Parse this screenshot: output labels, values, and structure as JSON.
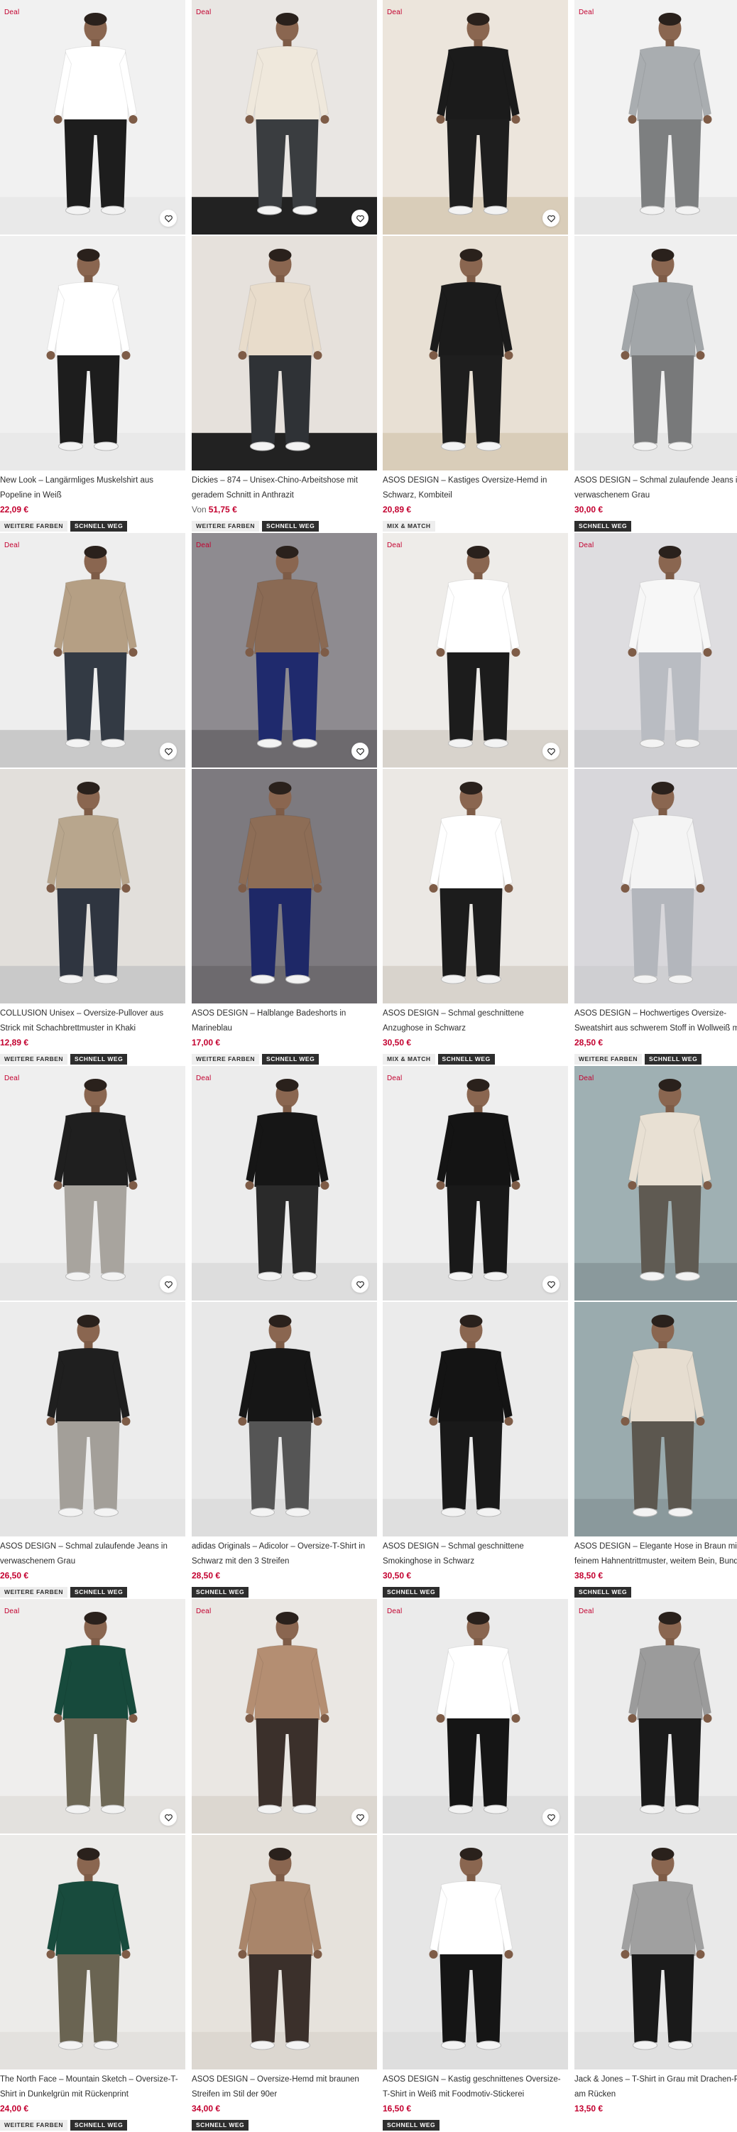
{
  "colors": {
    "deal": "#c3002f",
    "price": "#c3002f",
    "badge_dark": "#2d2d2d",
    "badge_light": "#eeeeee"
  },
  "icons": {
    "wishlist": "heart-icon"
  },
  "products": [
    {
      "deal": "Deal",
      "title": "New Look – Langärmliges Muskelshirt aus Popeline in Weiß",
      "price_prefix": "",
      "price": "22,09 €",
      "badges": [
        "WEITERE FARBEN",
        "SCHNELL WEG"
      ],
      "bg": [
        "#f1f1f1",
        "#f0f0f0"
      ],
      "top": [
        "#ffffff",
        "#ffffff"
      ],
      "bottom": [
        "#1d1d1d",
        "#1d1d1d"
      ],
      "floor": "#e9e9e9"
    },
    {
      "deal": "Deal",
      "title": "Dickies – 874 – Unisex-Chino-Arbeitshose mit geradem Schnitt in Anthrazit",
      "price_prefix": "Von",
      "price": "51,75 €",
      "badges": [
        "WEITERE FARBEN",
        "SCHNELL WEG"
      ],
      "bg": [
        "#e9e6e3",
        "#e6e1dc"
      ],
      "top": [
        "#efe8dc",
        "#e8dccb"
      ],
      "bottom": [
        "#3a3d40",
        "#2f3236"
      ],
      "floor": "#222222"
    },
    {
      "deal": "Deal",
      "title": "ASOS DESIGN – Kastiges Oversize-Hemd in Schwarz, Kombiteil",
      "price_prefix": "",
      "price": "20,89 €",
      "badges": [
        "MIX & MATCH"
      ],
      "bg": [
        "#ece5dc",
        "#e8e0d4"
      ],
      "top": [
        "#1b1b1b",
        "#1b1b1b"
      ],
      "bottom": [
        "#1e1e1e",
        "#1e1e1e"
      ],
      "floor": "#d9cdb9"
    },
    {
      "deal": "Deal",
      "title": "ASOS DESIGN – Schmal zulaufende Jeans in verwaschenem Grau",
      "price_prefix": "",
      "price": "30,00 €",
      "badges": [
        "SCHNELL WEG"
      ],
      "bg": [
        "#f2f2f2",
        "#f0f0f0"
      ],
      "top": [
        "#a9adb0",
        "#a2a6a9"
      ],
      "bottom": [
        "#7d7f80",
        "#78797a"
      ],
      "floor": "#e6e6e6"
    },
    {
      "deal": "Deal",
      "title": "COLLUSION Unisex – Oversize-Pullover aus Strick mit Schachbrettmuster in Khaki",
      "price_prefix": "",
      "price": "12,89 €",
      "badges": [
        "WEITERE FARBEN",
        "SCHNELL WEG"
      ],
      "bg": [
        "#eeeeee",
        "#e2dfdb"
      ],
      "top": [
        "#b59f84",
        "#b8a68d"
      ],
      "bottom": [
        "#333a44",
        "#2f3540"
      ],
      "floor": "#c9c9c9"
    },
    {
      "deal": "Deal",
      "title": "ASOS DESIGN – Halblange Badeshorts in Marineblau",
      "price_prefix": "",
      "price": "17,00 €",
      "badges": [
        "WEITERE FARBEN",
        "SCHNELL WEG"
      ],
      "bg": [
        "#8e8b90",
        "#7d7a7f"
      ],
      "top": [
        "#8a6a54",
        "#8d6d56"
      ],
      "bottom": [
        "#1f2a6d",
        "#1e2867"
      ],
      "floor": "#6d6a6e"
    },
    {
      "deal": "Deal",
      "title": "ASOS DESIGN – Schmal geschnittene Anzughose in Schwarz",
      "price_prefix": "",
      "price": "30,50 €",
      "badges": [
        "MIX & MATCH",
        "SCHNELL WEG"
      ],
      "bg": [
        "#eeece9",
        "#ebe8e4"
      ],
      "top": [
        "#ffffff",
        "#ffffff"
      ],
      "bottom": [
        "#1c1c1c",
        "#1c1c1c"
      ],
      "floor": "#d8d3cc"
    },
    {
      "deal": "Deal",
      "title": "ASOS DESIGN – Hochwertiges Oversize-Sweatshirt aus schwerem Stoff in Wollweiß mit kurzem Reißverschluss",
      "price_prefix": "",
      "price": "28,50 €",
      "badges": [
        "WEITERE FARBEN",
        "SCHNELL WEG"
      ],
      "bg": [
        "#dedde0",
        "#d8d7db"
      ],
      "top": [
        "#f7f7f7",
        "#f4f4f4"
      ],
      "bottom": [
        "#b9bcc2",
        "#b3b6bc"
      ],
      "floor": "#cfcfd2"
    },
    {
      "deal": "Deal",
      "title": "ASOS DESIGN – Schmal zulaufende Jeans in verwaschenem Grau",
      "price_prefix": "",
      "price": "26,50 €",
      "badges": [
        "WEITERE FARBEN",
        "SCHNELL WEG"
      ],
      "bg": [
        "#efefef",
        "#ececec"
      ],
      "top": [
        "#1f1f1f",
        "#1f1f1f"
      ],
      "bottom": [
        "#a8a49e",
        "#a39f99"
      ],
      "floor": "#e4e4e4"
    },
    {
      "deal": "Deal",
      "title": "adidas Originals – Adicolor – Oversize-T-Shirt in Schwarz mit den 3 Streifen",
      "price_prefix": "",
      "price": "28,50 €",
      "badges": [
        "SCHNELL WEG"
      ],
      "bg": [
        "#ececec",
        "#e8e8e8"
      ],
      "top": [
        "#161616",
        "#161616"
      ],
      "bottom": [
        "#2a2a2a",
        "#555555"
      ],
      "floor": "#dddddd"
    },
    {
      "deal": "Deal",
      "title": "ASOS DESIGN – Schmal geschnittene Smokinghose in Schwarz",
      "price_prefix": "",
      "price": "30,50 €",
      "badges": [
        "SCHNELL WEG"
      ],
      "bg": [
        "#eeeeee",
        "#ebebeb"
      ],
      "top": [
        "#141414",
        "#141414"
      ],
      "bottom": [
        "#191919",
        "#191919"
      ],
      "floor": "#dfdfdf"
    },
    {
      "deal": "Deal",
      "title": "ASOS DESIGN – Elegante Hose in Braun mit feinem Hahnentrittmuster, weitem Bein, Bundfalte und Saumumschlag",
      "price_prefix": "",
      "price": "38,50 €",
      "badges": [
        "SCHNELL WEG"
      ],
      "bg": [
        "#9fb0b3",
        "#9aabae"
      ],
      "top": [
        "#e8e0d3",
        "#e6ddd0"
      ],
      "bottom": [
        "#5f5a52",
        "#5c574f"
      ],
      "floor": "#8a999c"
    },
    {
      "deal": "Deal",
      "title": "The North Face – Mountain Sketch – Oversize-T-Shirt in Dunkelgrün mit Rückenprint",
      "price_prefix": "",
      "price": "24,00 €",
      "badges": [
        "WEITERE FARBEN",
        "SCHNELL WEG"
      ],
      "bg": [
        "#efeeed",
        "#ecebe9"
      ],
      "top": [
        "#174a3c",
        "#184b3d"
      ],
      "bottom": [
        "#6e6856",
        "#6a6452"
      ],
      "floor": "#e3e1de"
    },
    {
      "deal": "Deal",
      "title": "ASOS DESIGN – Oversize-Hemd mit braunen Streifen im Stil der 90er",
      "price_prefix": "",
      "price": "34,00 €",
      "badges": [
        "SCHNELL WEG"
      ],
      "bg": [
        "#eae7e3",
        "#e6e2dc"
      ],
      "top": [
        "#b48e72",
        "#a9856a"
      ],
      "bottom": [
        "#3b302b",
        "#3b302b"
      ],
      "floor": "#dcd7d0"
    },
    {
      "deal": "Deal",
      "title": "ASOS DESIGN – Kastig geschnittenes Oversize-T-Shirt in Weiß mit Foodmotiv-Stickerei",
      "price_prefix": "",
      "price": "16,50 €",
      "badges": [
        "SCHNELL WEG"
      ],
      "bg": [
        "#ebebeb",
        "#e6e6e6"
      ],
      "top": [
        "#ffffff",
        "#ffffff"
      ],
      "bottom": [
        "#151515",
        "#151515"
      ],
      "floor": "#dedede"
    },
    {
      "deal": "Deal",
      "title": "Jack & Jones – T-Shirt in Grau mit Drachen-Print am Rücken",
      "price_prefix": "",
      "price": "13,50 €",
      "badges": [],
      "bg": [
        "#ececec",
        "#e9e9e9"
      ],
      "top": [
        "#9b9b9b",
        "#a0a0a0"
      ],
      "bottom": [
        "#1a1a1a",
        "#1a1a1a"
      ],
      "floor": "#e0e0e0"
    }
  ]
}
